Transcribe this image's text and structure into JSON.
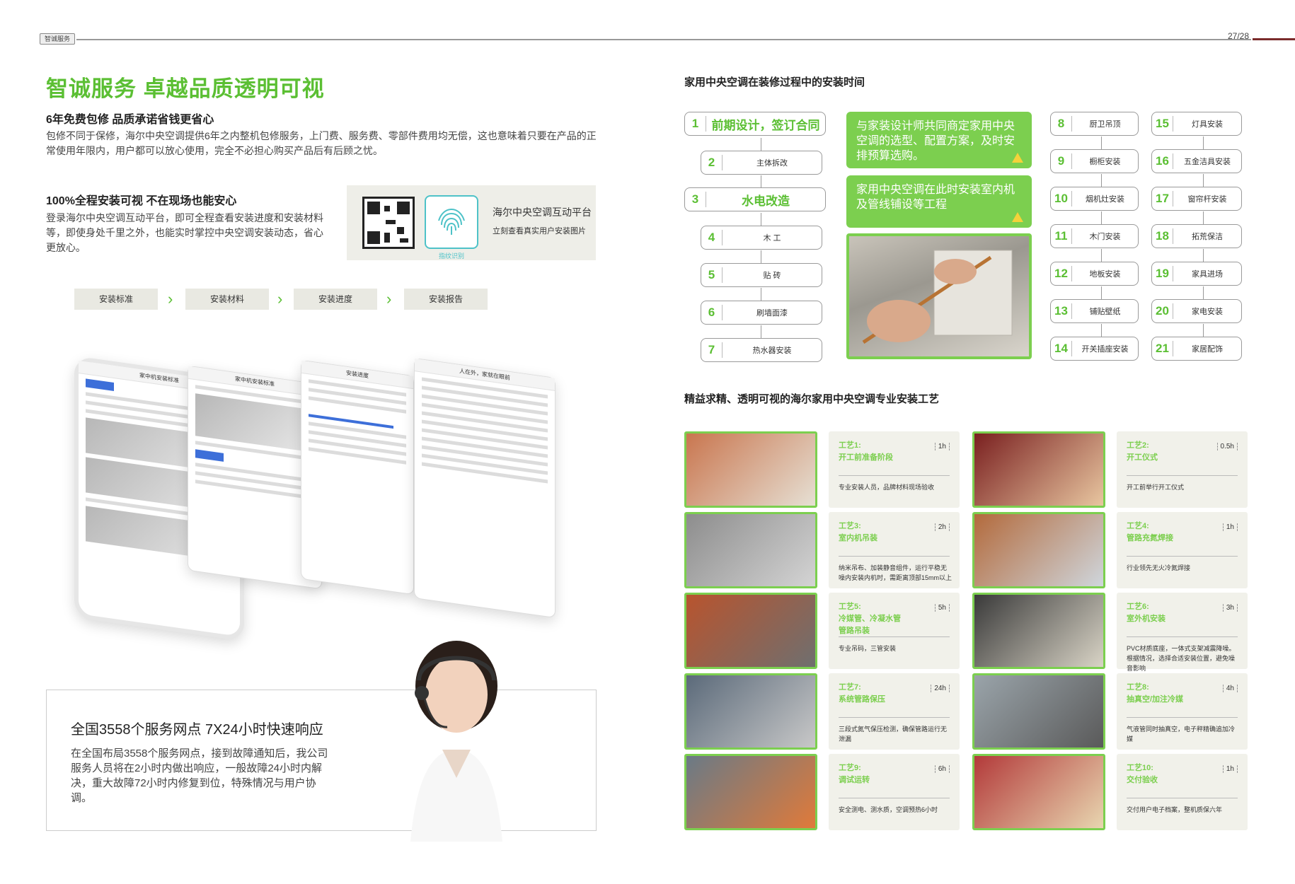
{
  "header": {
    "tag": "智诚服务",
    "page": "27/28"
  },
  "left": {
    "title": "智诚服务  卓越品质透明可视",
    "s1_heading": "6年免费包修 品质承诺省钱更省心",
    "s1_body": "包修不同于保修，海尔中央空调提供6年之内整机包修服务，上门费、服务费、零部件费用均无偿，这也意味着只要在产品的正常使用年限内，用户都可以放心使用，完全不必担心购买产品后有后顾之忧。",
    "s2_heading": "100%全程安装可视 不在现场也能安心",
    "s2_body": "登录海尔中央空调互动平台，即可全程查看安装进度和安装材料等，即使身处千里之外，也能实时掌控中央空调安装动态，省心更放心。",
    "platform_title": "海尔中央空调互动平台",
    "platform_sub": "立刻查看真实用户安装图片",
    "fingerprint_label": "指纹识别",
    "steps": [
      "安装标准",
      "安装材料",
      "安装进度",
      "安装报告"
    ],
    "phones": [
      "家中机安装标准",
      "家中机安装标准",
      "安装进度",
      "人在外，家就在眼前"
    ],
    "service_heading": "全国3558个服务网点 7X24小时快速响应",
    "service_body": "在全国布局3558个服务网点，接到故障通知后，我公司服务人员将在2小时内做出响应，一般故障24小时内解决，重大故障72小时内修复到位，特殊情况与用户协调。"
  },
  "right": {
    "timeline_title": "家用中央空调在装修过程中的安装时间",
    "col1": [
      {
        "n": "1",
        "t": "前期设计，签订合同"
      },
      {
        "n": "2",
        "t": "主体拆改"
      },
      {
        "n": "3",
        "t": "水电改造"
      },
      {
        "n": "4",
        "t": "木 工"
      },
      {
        "n": "5",
        "t": "贴 砖"
      },
      {
        "n": "6",
        "t": "刷墙面漆"
      },
      {
        "n": "7",
        "t": "热水器安装"
      }
    ],
    "callout1": "与家装设计师共同商定家用中央空调的选型、配置方案，及时安排预算选购。",
    "callout2": "家用中央空调在此时安装室内机及管线铺设等工程",
    "col2": [
      {
        "n": "8",
        "t": "厨卫吊顶"
      },
      {
        "n": "9",
        "t": "橱柜安装"
      },
      {
        "n": "10",
        "t": "烟机灶安装"
      },
      {
        "n": "11",
        "t": "木门安装"
      },
      {
        "n": "12",
        "t": "地板安装"
      },
      {
        "n": "13",
        "t": "铺贴壁纸"
      },
      {
        "n": "14",
        "t": "开关插座安装"
      }
    ],
    "col3": [
      {
        "n": "15",
        "t": "灯具安装"
      },
      {
        "n": "16",
        "t": "五金洁具安装"
      },
      {
        "n": "17",
        "t": "窗帘杆安装"
      },
      {
        "n": "18",
        "t": "拓荒保洁"
      },
      {
        "n": "19",
        "t": "家具进场"
      },
      {
        "n": "20",
        "t": "家电安装"
      },
      {
        "n": "21",
        "t": "家居配饰"
      }
    ],
    "craft_title": "精益求精、透明可视的海尔家用中央空调专业安装工艺",
    "crafts": [
      {
        "title": "工艺1:\n开工前准备阶段",
        "hours": "1h",
        "desc": "专业安装人员，品牌材料现场验收"
      },
      {
        "title": "工艺2:\n开工仪式",
        "hours": "0.5h",
        "desc": "开工前举行开工仪式"
      },
      {
        "title": "工艺3:\n室内机吊装",
        "hours": "2h",
        "desc": "纳米吊布、加装静音组件，运行平稳无噪内安装内机时，需距离顶部15mm以上"
      },
      {
        "title": "工艺4:\n管路充氮焊接",
        "hours": "1h",
        "desc": "行业领先无火冷氮焊接"
      },
      {
        "title": "工艺5:\n冷媒管、冷凝水管\n管路吊装",
        "hours": "5h",
        "desc": "专业吊码，三管安装"
      },
      {
        "title": "工艺6:\n室外机安装",
        "hours": "3h",
        "desc": "PVC材质底座，一体式支架减震降噪。根据情况，选择合适安装位置，避免噪音影响"
      },
      {
        "title": "工艺7:\n系统管路保压",
        "hours": "24h",
        "desc": "三段式氮气保压检测，确保管路运行无泄漏"
      },
      {
        "title": "工艺8:\n抽真空/加注冷媒",
        "hours": "4h",
        "desc": "气液管同时抽真空，电子秤精确追加冷媒"
      },
      {
        "title": "工艺9:\n调试运转",
        "hours": "6h",
        "desc": "安全测电、测水质，空调预热6小时"
      },
      {
        "title": "工艺10:\n交付验收",
        "hours": "1h",
        "desc": "交付用户电子档案，整机质保六年"
      }
    ]
  }
}
